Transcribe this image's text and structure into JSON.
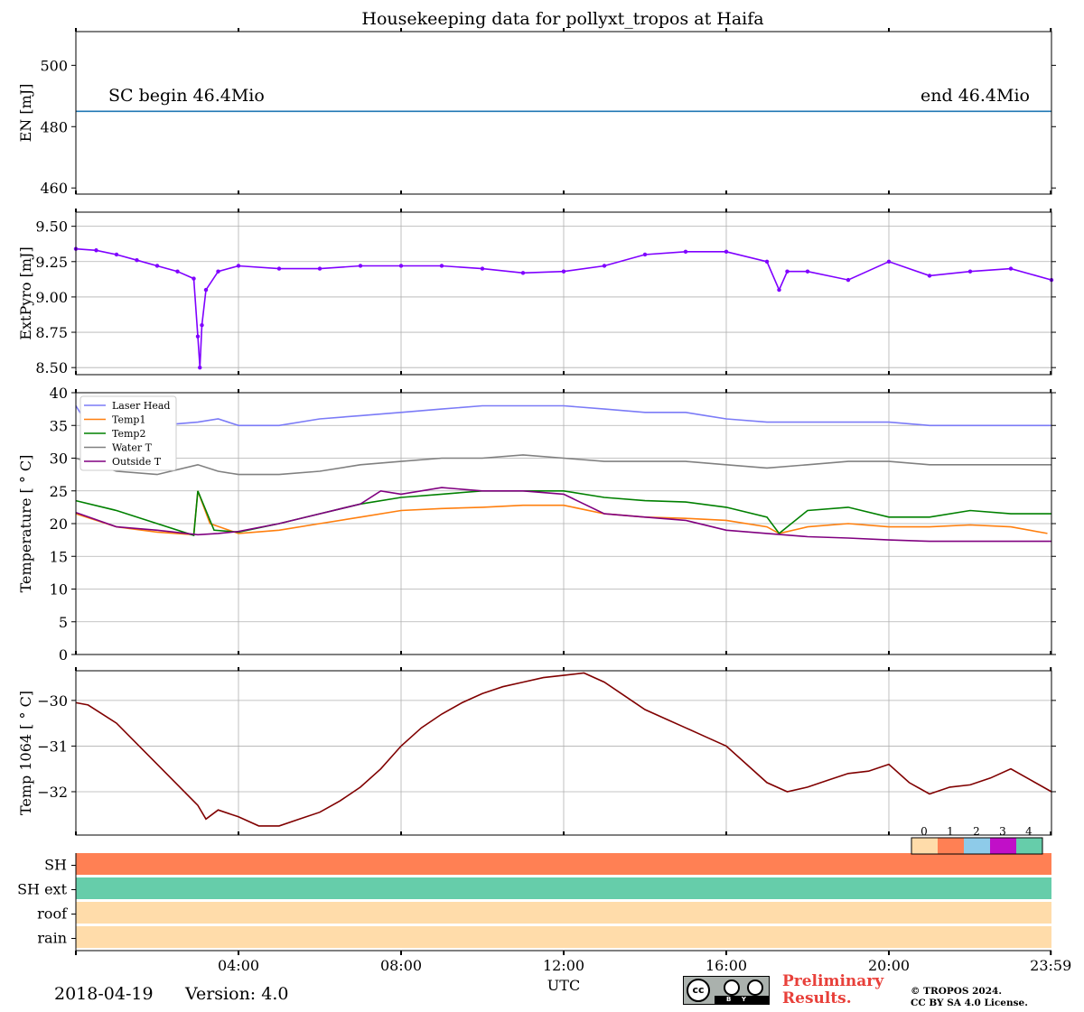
{
  "figure": {
    "title": "Housekeeping data for pollyxt_tropos at Haifa",
    "date": "2018-04-19",
    "version": "Version: 4.0",
    "preliminary": "Preliminary",
    "preliminary2": "Results.",
    "copyright1": "© TROPOS 2024.",
    "copyright2": "CC BY SA 4.0 License.",
    "cc_labels": [
      "cc",
      "BY",
      "SA"
    ]
  },
  "chart_data": [
    {
      "type": "line",
      "id": "energy",
      "ylabel": "EN [mJ]",
      "ylim": [
        458,
        511
      ],
      "yticks": [
        460,
        480,
        500
      ],
      "annotation_left": "SC begin 46.4Mio",
      "annotation_right": "end 46.4Mio",
      "series": [
        {
          "color": "#1f77b4",
          "x_hours": [
            0,
            24
          ],
          "values": [
            485,
            485
          ]
        }
      ]
    },
    {
      "type": "line",
      "id": "extpyro",
      "ylabel": "ExtPyro [mJ]",
      "ylim": [
        8.45,
        9.6
      ],
      "yticks": [
        8.5,
        8.75,
        9.0,
        9.25,
        9.5
      ],
      "ytick_labels": [
        "8.50",
        "8.75",
        "9.00",
        "9.25",
        "9.50"
      ],
      "grid": true,
      "series": [
        {
          "color": "#7f00ff",
          "marker": "dot",
          "x_hours": [
            0,
            0.5,
            1.0,
            1.5,
            2.0,
            2.5,
            2.9,
            3.0,
            3.05,
            3.1,
            3.2,
            3.5,
            4.0,
            5.0,
            6.0,
            7.0,
            8.0,
            9.0,
            10.0,
            11.0,
            12.0,
            13.0,
            14.0,
            15.0,
            16.0,
            17.0,
            17.3,
            17.5,
            18.0,
            19.0,
            20.0,
            21.0,
            22.0,
            23.0,
            24.0
          ],
          "values": [
            9.34,
            9.33,
            9.3,
            9.26,
            9.22,
            9.18,
            9.13,
            8.72,
            8.5,
            8.8,
            9.05,
            9.18,
            9.22,
            9.2,
            9.2,
            9.22,
            9.22,
            9.22,
            9.2,
            9.17,
            9.18,
            9.22,
            9.3,
            9.32,
            9.32,
            9.25,
            9.05,
            9.18,
            9.18,
            9.12,
            9.25,
            9.15,
            9.18,
            9.2,
            9.12
          ]
        }
      ]
    },
    {
      "type": "line",
      "id": "temperature",
      "ylabel": "Temperature [$^\\circ C$]",
      "ylim": [
        0,
        40
      ],
      "yticks": [
        0,
        5,
        10,
        15,
        20,
        25,
        30,
        35,
        40
      ],
      "grid": true,
      "legend_position": "upper-left",
      "series": [
        {
          "name": "Laser Head",
          "color": "#7b7bf7",
          "x_hours": [
            0,
            0.3,
            1.0,
            2.0,
            3.0,
            3.5,
            4.0,
            5.0,
            6.0,
            7.0,
            8.0,
            9.0,
            10.0,
            11.0,
            12.0,
            13.0,
            14.0,
            15.0,
            15.5,
            16.0,
            17.0,
            18.0,
            19.0,
            20.0,
            21.0,
            22.0,
            23.0,
            24.0
          ],
          "values": [
            38,
            35,
            35,
            35,
            35.5,
            36,
            35,
            35,
            36,
            36.5,
            37,
            37.5,
            38,
            38,
            38,
            37.5,
            37,
            37,
            36.5,
            36,
            35.5,
            35.5,
            35.5,
            35.5,
            35,
            35,
            35,
            35
          ]
        },
        {
          "name": "Temp1",
          "color": "#ff7f0e",
          "x_hours": [
            0,
            1.0,
            2.0,
            2.9,
            3.0,
            3.3,
            4.0,
            5.0,
            6.0,
            7.0,
            8.0,
            9.0,
            10.0,
            11.0,
            12.0,
            13.0,
            14.0,
            15.0,
            16.0,
            17.0,
            17.3,
            18.0,
            19.0,
            20.0,
            21.0,
            22.0,
            23.0,
            23.9
          ],
          "values": [
            21.5,
            19.5,
            18.7,
            18.3,
            25.0,
            20.0,
            18.5,
            19.0,
            20.0,
            21.0,
            22.0,
            22.3,
            22.5,
            22.8,
            22.8,
            21.5,
            21.0,
            20.8,
            20.5,
            19.5,
            18.5,
            19.5,
            20.0,
            19.5,
            19.5,
            19.8,
            19.5,
            18.5
          ]
        },
        {
          "name": "Temp2",
          "color": "#008000",
          "x_hours": [
            0,
            1.0,
            2.0,
            2.9,
            3.0,
            3.4,
            4.0,
            5.0,
            6.0,
            7.0,
            8.0,
            9.0,
            10.0,
            11.0,
            12.0,
            13.0,
            14.0,
            15.0,
            16.0,
            17.0,
            17.3,
            18.0,
            19.0,
            20.0,
            21.0,
            22.0,
            23.0,
            24.0
          ],
          "values": [
            23.5,
            22.0,
            20.0,
            18.2,
            25.0,
            19.0,
            18.7,
            20.0,
            21.5,
            23.0,
            24.0,
            24.5,
            25.0,
            25.0,
            25.0,
            24.0,
            23.5,
            23.3,
            22.5,
            21.0,
            18.5,
            22.0,
            22.5,
            21.0,
            21.0,
            22.0,
            21.5,
            21.5
          ]
        },
        {
          "name": "Water T",
          "color": "#808080",
          "x_hours": [
            0,
            0.5,
            1.0,
            2.0,
            3.0,
            3.5,
            4.0,
            5.0,
            6.0,
            7.0,
            8.0,
            9.0,
            10.0,
            11.0,
            12.0,
            13.0,
            14.0,
            15.0,
            16.0,
            17.0,
            18.0,
            19.0,
            20.0,
            21.0,
            22.0,
            23.0,
            24.0
          ],
          "values": [
            30,
            29,
            28,
            27.5,
            29,
            28,
            27.5,
            27.5,
            28,
            29,
            29.5,
            30,
            30,
            30.5,
            30,
            29.5,
            29.5,
            29.5,
            29,
            28.5,
            29,
            29.5,
            29.5,
            29,
            29,
            29,
            29
          ]
        },
        {
          "name": "Outside T",
          "color": "#800080",
          "x_hours": [
            0,
            1.0,
            2.0,
            3.0,
            3.5,
            4.0,
            5.0,
            6.0,
            7.0,
            7.5,
            8.0,
            9.0,
            10.0,
            11.0,
            12.0,
            13.0,
            14.0,
            15.0,
            16.0,
            17.0,
            18.0,
            19.0,
            20.0,
            21.0,
            22.0,
            23.0,
            24.0
          ],
          "values": [
            21.7,
            19.5,
            19.0,
            18.3,
            18.5,
            18.8,
            20.0,
            21.5,
            23.0,
            25.0,
            24.5,
            25.5,
            25.0,
            25.0,
            24.5,
            21.5,
            21.0,
            20.5,
            19.0,
            18.5,
            18.0,
            17.8,
            17.5,
            17.3,
            17.3,
            17.3,
            17.3
          ]
        }
      ]
    },
    {
      "type": "line",
      "id": "temp1064",
      "ylabel": "Temp 1064 [$^\\circ C$]",
      "ylim": [
        -32.95,
        -29.35
      ],
      "yticks": [
        -30,
        -31,
        -32
      ],
      "ytick_labels": [
        "−30",
        "−31",
        "−32"
      ],
      "grid": true,
      "series": [
        {
          "color": "#800000",
          "x_hours": [
            0,
            0.3,
            1.0,
            2.0,
            3.0,
            3.2,
            3.5,
            4.0,
            4.5,
            5.0,
            5.5,
            6.0,
            6.5,
            7.0,
            7.5,
            8.0,
            8.5,
            9.0,
            9.5,
            10.0,
            10.5,
            11.0,
            11.5,
            12.0,
            12.5,
            13.0,
            13.5,
            14.0,
            14.5,
            15.0,
            15.5,
            16.0,
            16.5,
            17.0,
            17.5,
            18.0,
            18.5,
            19.0,
            19.5,
            20.0,
            20.5,
            21.0,
            21.5,
            22.0,
            22.5,
            23.0,
            23.5,
            24.0
          ],
          "values": [
            -30.05,
            -30.1,
            -30.5,
            -31.4,
            -32.3,
            -32.6,
            -32.4,
            -32.55,
            -32.75,
            -32.75,
            -32.6,
            -32.45,
            -32.2,
            -31.9,
            -31.5,
            -31.0,
            -30.6,
            -30.3,
            -30.05,
            -29.85,
            -29.7,
            -29.6,
            -29.5,
            -29.45,
            -29.4,
            -29.6,
            -29.9,
            -30.2,
            -30.4,
            -30.6,
            -30.8,
            -31.0,
            -31.4,
            -31.8,
            -32.0,
            -31.9,
            -31.75,
            -31.6,
            -31.55,
            -31.4,
            -31.8,
            -32.05,
            -31.9,
            -31.85,
            -31.7,
            -31.5,
            -31.75,
            -32.0
          ]
        }
      ]
    },
    {
      "type": "heatmap",
      "id": "status",
      "rows": [
        "SH",
        "SH ext",
        "roof",
        "rain"
      ],
      "row_values": [
        1,
        4,
        0,
        0
      ],
      "colorbar_ticks": [
        "0",
        "1",
        "2",
        "3",
        "4"
      ],
      "colorbar_colors": [
        "#ffdcaa",
        "#ff8054",
        "#8ecbe9",
        "#c10fc8",
        "#66cdaa"
      ],
      "xlabel": "UTC",
      "xticks_hours": [
        4,
        8,
        12,
        16,
        20,
        23.983
      ],
      "xtick_labels": [
        "04:00",
        "08:00",
        "12:00",
        "16:00",
        "20:00",
        "23:59"
      ]
    }
  ]
}
